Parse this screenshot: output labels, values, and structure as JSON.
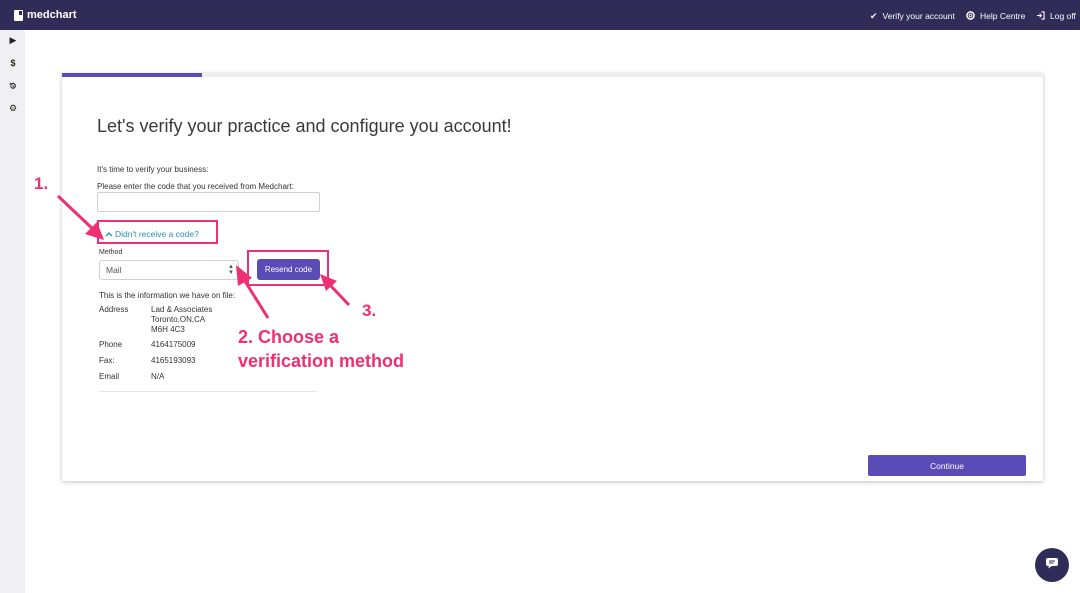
{
  "app": {
    "name": "medchart"
  },
  "nav": {
    "verify_label": "Verify your account",
    "help_label": "Help Centre",
    "logoff_label": "Log off"
  },
  "sidebar": {
    "icons": [
      "play-icon",
      "dollar-icon",
      "history-icon",
      "gear-icon"
    ]
  },
  "progress": {
    "fraction": 0.143
  },
  "page": {
    "title": "Let's verify your practice and configure you account!",
    "intro": "It's time to verify your business:",
    "code_prompt": "Please enter the code that you received from Medchart:",
    "code_value": "",
    "toggle_label": "Didn't receive a code?",
    "method_label": "Method",
    "method_value": "Mail",
    "resend_label": "Resend code",
    "info_heading": "This is the information we have on file:",
    "info": {
      "address_label": "Address",
      "address_line1": "Lad & Associates",
      "address_line2": "Toronto,ON,CA",
      "address_line3": "M6H 4C3",
      "phone_label": "Phone",
      "phone_value": "4164175009",
      "fax_label": "Fax:",
      "fax_value": "4165193093",
      "email_label": "Email",
      "email_value": "N/A"
    },
    "continue_label": "Continue"
  },
  "annotations": {
    "step1": "1.",
    "step2_line1": "2. Choose a",
    "step2_line2": "verification method",
    "step3": "3.",
    "color": "#ee2f72"
  },
  "colors": {
    "accent": "#5a4bb7",
    "topbar": "#2f2c58",
    "link": "#2a8fb5"
  }
}
